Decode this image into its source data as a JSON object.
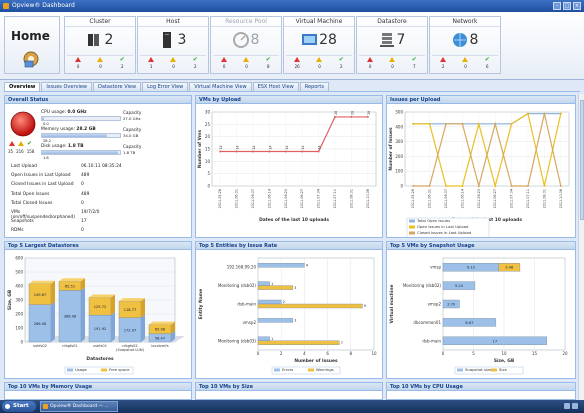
{
  "window": {
    "title": "Opview® Dashboard"
  },
  "home": {
    "label": "Home"
  },
  "inventory": [
    {
      "name": "Cluster",
      "count": "2",
      "dim": false,
      "icon": "server-cluster-icon",
      "stats": [
        "0",
        "0",
        "2"
      ]
    },
    {
      "name": "Host",
      "count": "3",
      "dim": false,
      "icon": "host-server-icon",
      "stats": [
        "1",
        "0",
        "2"
      ]
    },
    {
      "name": "Resource Pool",
      "count": "8",
      "dim": true,
      "icon": "resource-pool-icon",
      "stats": [
        "0",
        "0",
        "8"
      ]
    },
    {
      "name": "Virtual Machine",
      "count": "28",
      "dim": false,
      "icon": "virtual-machine-icon",
      "stats": [
        "26",
        "0",
        "2"
      ]
    },
    {
      "name": "Datastore",
      "count": "7",
      "dim": false,
      "icon": "datastore-icon",
      "stats": [
        "0",
        "0",
        "7"
      ]
    },
    {
      "name": "Network",
      "count": "8",
      "dim": false,
      "icon": "network-globe-icon",
      "stats": [
        "2",
        "0",
        "6"
      ]
    }
  ],
  "tabs": [
    "Overview",
    "Issues Overview",
    "Datastore View",
    "Log Error View",
    "Virtual Machine View",
    "ESX Host View",
    "Reports"
  ],
  "overall": {
    "title": "Overall Status",
    "cpu_label": "CPU usage:",
    "cpu_value": "0.0 GHz",
    "cpu_capacity_label": "Capacity",
    "cpu_capacity": "27.0 GHz",
    "cpu_used": "0.0",
    "cpu_fill": 0.02,
    "mem_label": "Memory usage:",
    "mem_value": "28.2 GB",
    "mem_capacity_label": "Capacity",
    "mem_capacity": "34.0 GB",
    "mem_used": "28.2",
    "mem_fill": 0.83,
    "disk_label": "Disk usage:",
    "disk_value": "1.8 TB",
    "disk_capacity_label": "Capacity",
    "disk_capacity": "1.8 TB",
    "disk_used": "1.8",
    "disk_fill": 0.98,
    "alarm_counts": [
      "35",
      "216",
      "158"
    ],
    "rows": [
      {
        "label": "Last Upload",
        "value": "06.10.11 08:35:24"
      },
      {
        "label": "Open Issues in Last Upload",
        "value": "489"
      },
      {
        "label": "Closed Issues in Last Upload",
        "value": "0"
      },
      {
        "label": "Total Open Issues",
        "value": "489"
      },
      {
        "label": "Total Closed Issues",
        "value": "0"
      },
      {
        "label": "VMs (on/off/suspended/orphaned)",
        "value": "19/7/2/0"
      },
      {
        "label": "Snapshots",
        "value": "17"
      },
      {
        "label": "RDMs",
        "value": "0"
      }
    ]
  },
  "panels": {
    "vms_per_upload": "VMs by Upload",
    "issues_per_upload": "Issues per Upload",
    "top_datastores": "Top 5 Largest Datastores",
    "top_entities": "Top 5 Entities by Issue Rate",
    "top_snapshots": "Top 5 VMs by Snapshot Usage",
    "top_memory": "Top 10 VMs by Memory Usage",
    "top_size": "Top 10 VMs by Size",
    "top_cpu": "Top 10 VMs by CPU Usage"
  },
  "chart_data": [
    {
      "type": "line",
      "title": "VMs by Upload",
      "xlabel": "Dates of the last 10 uploads",
      "ylabel": "Number of Vms",
      "x": [
        "2011.05.26",
        "2011.06.01",
        "2011.06.07",
        "2011.06.14",
        "2011.06.20",
        "2011.06.27",
        "2011.07.04",
        "2011.07.11",
        "2011.08.01",
        "2011.10.06"
      ],
      "series": [
        {
          "name": "",
          "values": [
            14,
            14,
            14,
            14,
            14,
            14,
            14,
            28,
            28,
            28
          ]
        }
      ],
      "yticks": [
        0,
        5,
        10,
        15,
        20,
        25,
        30
      ],
      "ylim": [
        0,
        30
      ],
      "color": "#e06060"
    },
    {
      "type": "line",
      "title": "Issues per Upload",
      "xlabel": "Dates of the last 10 uploads",
      "ylabel": "Number of Issues",
      "x": [
        "2011.05.26",
        "2011.06.01",
        "2011.06.07",
        "2011.06.14",
        "2011.06.20",
        "2011.06.27",
        "2011.07.04",
        "2011.07.11",
        "2011.08.01",
        "2011.10.06"
      ],
      "series": [
        {
          "name": "Total Open Issues",
          "values": [
            420,
            420,
            420,
            420,
            420,
            420,
            420,
            489,
            489,
            489
          ],
          "color": "#8fb4e0"
        },
        {
          "name": "Open Issues in Last Upload",
          "values": [
            420,
            420,
            0,
            0,
            420,
            0,
            420,
            489,
            0,
            489
          ],
          "color": "#e8c020"
        },
        {
          "name": "Closed Issues in Last Upload",
          "values": [
            0,
            0,
            420,
            420,
            0,
            420,
            0,
            0,
            489,
            0
          ],
          "color": "#d4a860"
        }
      ],
      "yticks": [
        0,
        100,
        200,
        300,
        400,
        500
      ],
      "ylim": [
        0,
        500
      ],
      "legend": "bottom"
    },
    {
      "type": "bar",
      "title": "Top 5 Largest Datastores",
      "xlabel": "Datastores",
      "ylabel": "Size, GB",
      "categories": [
        "vshfs02",
        "nfsgfs01",
        "vshfs01",
        "nfsgfs02 (Snapshot LUN)",
        "localvmfs"
      ],
      "series": [
        {
          "name": "Usage",
          "values": [
            266.06,
            368.08,
            191.92,
            172.97,
            58.47
          ],
          "color": "#9cc0e8"
        },
        {
          "name": "Free space",
          "values": [
            149.67,
            65.51,
            125.72,
            118.77,
            65.98
          ],
          "color": "#f0c040"
        }
      ],
      "yticks": [
        0,
        100,
        200,
        300,
        400,
        500,
        600
      ],
      "ylim": [
        0,
        600
      ],
      "stacked": true,
      "legend": "bottom"
    },
    {
      "type": "bar",
      "orientation": "horizontal",
      "title": "Top 5 Entities by Issue Rate",
      "xlabel": "Number of Issues",
      "ylabel": "Entity Name",
      "categories": [
        "192.168.99.20",
        "Monitoring (dsb02)",
        "dsb-main",
        "vmsp2",
        "Monitoring (dsb03)"
      ],
      "series": [
        {
          "name": "Errors",
          "values": [
            4,
            1,
            2,
            3,
            1
          ],
          "color": "#9cc0e8"
        },
        {
          "name": "Warnings",
          "values": [
            0,
            3,
            9,
            0,
            7
          ],
          "color": "#f0c040"
        }
      ],
      "xticks": [
        0,
        2,
        4,
        6,
        8,
        10
      ],
      "xlim": [
        0,
        10
      ],
      "legend": "bottom"
    },
    {
      "type": "bar",
      "orientation": "horizontal",
      "stacked": true,
      "title": "Top 5 VMs by Snapshot Usage",
      "xlabel": "Size, GB",
      "ylabel": "Virtual machine",
      "categories": [
        "vmsp",
        "Monitoring (dsb02)",
        "vmsp2",
        "dbcommon01",
        "dsb-main"
      ],
      "series": [
        {
          "name": "Snapshot size",
          "values": [
            9.13,
            5.24,
            2.7,
            8.67,
            17.0
          ],
          "color": "#9cc0e8"
        },
        {
          "name": "Size",
          "values": [
            3.48,
            0,
            0,
            0,
            0
          ],
          "color": "#f0c040"
        }
      ],
      "labels": [
        "9.13",
        "5.24",
        "2.70",
        "8.67",
        "17"
      ],
      "labels2": [
        "3.48",
        "",
        "",
        "",
        ""
      ],
      "xticks": [
        0,
        5,
        10,
        15,
        20
      ],
      "xlim": [
        0,
        20
      ],
      "legend": "bottom"
    }
  ],
  "taskbar": {
    "start": "Start",
    "task": "Opview® Dashboard — ..."
  }
}
